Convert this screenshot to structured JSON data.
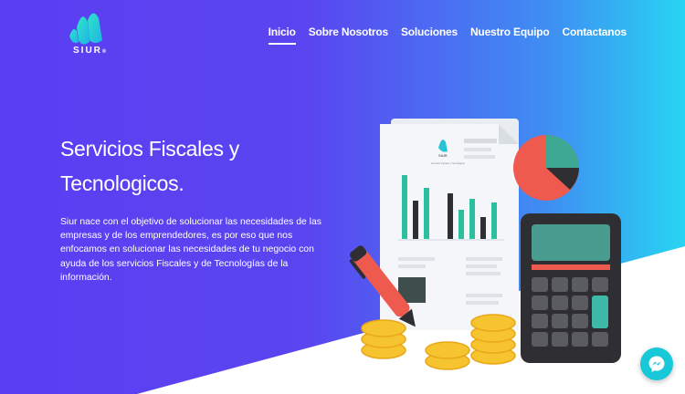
{
  "brand": {
    "name": "SIUR",
    "mark": "®",
    "doc_brand": "SIUR.",
    "doc_tagline": "Servicios Fiscales y Tecnológicos"
  },
  "nav": {
    "items": [
      "Inicio",
      "Sobre Nosotros",
      "Soluciones",
      "Nuestro Equipo",
      "Contactanos"
    ],
    "active": "Inicio"
  },
  "hero": {
    "title_line1": "Servicios Fiscales y",
    "title_line2": "Tecnologicos.",
    "description": "Siur nace con el objetivo de solucionar las necesidades de las empresas y de los emprendedores, es por eso que nos enfocamos en solucionar las necesidades de tu negocio con ayuda de los servicios Fiscales y de Tecnologías de la información."
  },
  "colors": {
    "gradient_start": "#5a3ef2",
    "gradient_end": "#28d4f1",
    "teal": "#2bbf9f",
    "coral": "#ef5a4f",
    "dark": "#2e2e33"
  },
  "icons": {
    "messenger": "messenger-icon"
  }
}
